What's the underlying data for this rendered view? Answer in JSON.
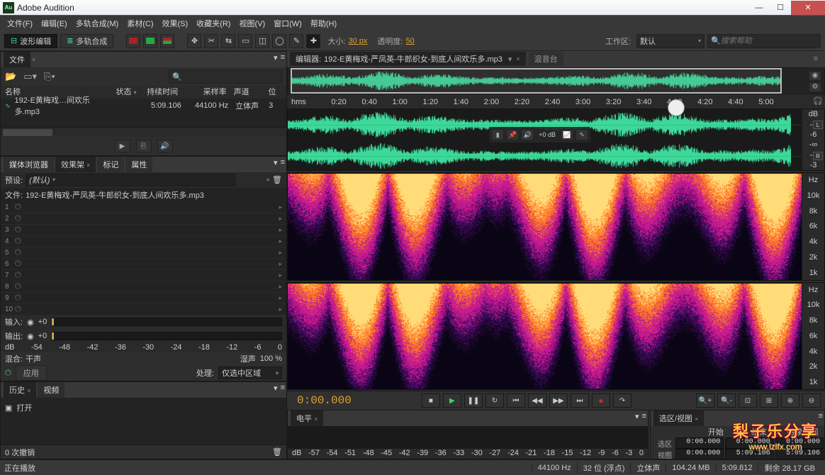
{
  "window": {
    "title": "Adobe Audition",
    "app_icon": "Au"
  },
  "window_buttons": {
    "min": "—",
    "max": "☐",
    "close": "✕"
  },
  "menus": [
    "文件(F)",
    "编辑(E)",
    "多轨合成(M)",
    "素材(C)",
    "效果(S)",
    "收藏夹(R)",
    "视图(V)",
    "窗口(W)",
    "帮助(H)"
  ],
  "toolbar": {
    "mode_wave": "波形编辑",
    "mode_multi": "多轨合成",
    "brush_size_label": "大小:",
    "brush_size_value": "30 px",
    "opacity_label": "透明度:",
    "opacity_value": "50",
    "workspace_label": "工作区:",
    "workspace_value": "默认",
    "search_placeholder": "搜索帮助",
    "search_icon": "🔍"
  },
  "files_panel": {
    "tab": "文件",
    "columns": {
      "name": "名称",
      "status": "状态",
      "duration": "持续时间",
      "rate": "采样率",
      "channels": "声道",
      "bit": "位"
    },
    "rows": [
      {
        "name": "192-E黄梅戏…间欢乐多.mp3",
        "duration": "5:09.106",
        "rate": "44100 Hz",
        "channels": "立体声",
        "bit": "3"
      }
    ],
    "play_icon": "▶",
    "open_icon": "⎘",
    "speaker_icon": "🔊"
  },
  "rack_panel": {
    "tabs": [
      "媒体浏览器",
      "效果架",
      "标记",
      "属性"
    ],
    "active_tab": 1,
    "preset_label": "预设:",
    "preset_value": "(默认)",
    "file_label": "文件:",
    "file_value": "192-E黄梅戏-严凤英-牛郎织女-到底人间欢乐多.mp3",
    "slots": [
      1,
      2,
      3,
      4,
      5,
      6,
      7,
      8,
      9,
      10
    ],
    "input_label": "输入:",
    "input_value": "+0",
    "output_label": "输出:",
    "output_value": "+0",
    "ruler": [
      "dB",
      "-54",
      "-48",
      "-42",
      "-36",
      "-30",
      "-24",
      "-18",
      "-12",
      "-6",
      "0"
    ],
    "mix_label": "混合:",
    "mix_dry": "干声",
    "mix_wet": "湿声",
    "mix_value": "100 %",
    "power_icon": "⏻",
    "apply": "应用",
    "process_label": "处理:",
    "process_value": "仅选中区域"
  },
  "history_panel": {
    "tabs": [
      "历史",
      "视频"
    ],
    "items": [
      {
        "icon": "▣",
        "label": "打开"
      }
    ],
    "undo_text": "0 次撤销"
  },
  "editor": {
    "tab_prefix": "编辑器:",
    "tab_file": "192-E黄梅戏-严凤英-牛郎织女-到底人间欢乐多.mp3",
    "tab_other": "混音台",
    "timeline_hms": "hms",
    "timeline_ticks": [
      "0:20",
      "0:40",
      "1:00",
      "1:20",
      "1:40",
      "2:00",
      "2:20",
      "2:40",
      "3:00",
      "3:20",
      "3:40",
      "4:00",
      "4:20",
      "4:40",
      "5:00"
    ],
    "db_marks": [
      "dB",
      "-3",
      "-6",
      "-∞",
      "-6",
      "-3"
    ],
    "ch_left": "L",
    "ch_right": "R",
    "hz_label": "Hz",
    "hz_marks": [
      "10k",
      "8k",
      "6k",
      "4k",
      "2k",
      "1k"
    ],
    "hud_db": "+0 dB"
  },
  "transport": {
    "timecode": "0:00.000",
    "buttons": {
      "stop": "■",
      "play": "▶",
      "pause": "❚❚",
      "loop": "↻",
      "to_start": "⏮",
      "rew": "◀◀",
      "ffw": "▶▶",
      "to_end": "⏭",
      "rec": "●",
      "skip": "↷"
    }
  },
  "levels_panel": {
    "tab": "电平",
    "ruler": [
      "dB",
      "-57",
      "-54",
      "-51",
      "-48",
      "-45",
      "-42",
      "-39",
      "-36",
      "-33",
      "-30",
      "-27",
      "-24",
      "-21",
      "-18",
      "-15",
      "-12",
      "-9",
      "-6",
      "-3",
      "0"
    ]
  },
  "selview_panel": {
    "tab": "选区/视图",
    "headers": [
      "开始",
      "结束",
      "持续时间"
    ],
    "rows": [
      {
        "label": "选区",
        "start": "0:00.000",
        "end": "0:00.000",
        "dur": "0:00.000"
      },
      {
        "label": "视图",
        "start": "0:00.000",
        "end": "5:09.106",
        "dur": "5:09.106"
      }
    ]
  },
  "status": {
    "playing": "正在播放",
    "rate": "44100 Hz",
    "bits": "32 位 (浮点)",
    "channels": "立体声",
    "size": "104.24 MB",
    "duration": "5:09.812",
    "disk": "剩余 28.17 GB"
  },
  "watermark": {
    "line1": "梨子乐分享",
    "line2": "www.lzlfx.com"
  }
}
